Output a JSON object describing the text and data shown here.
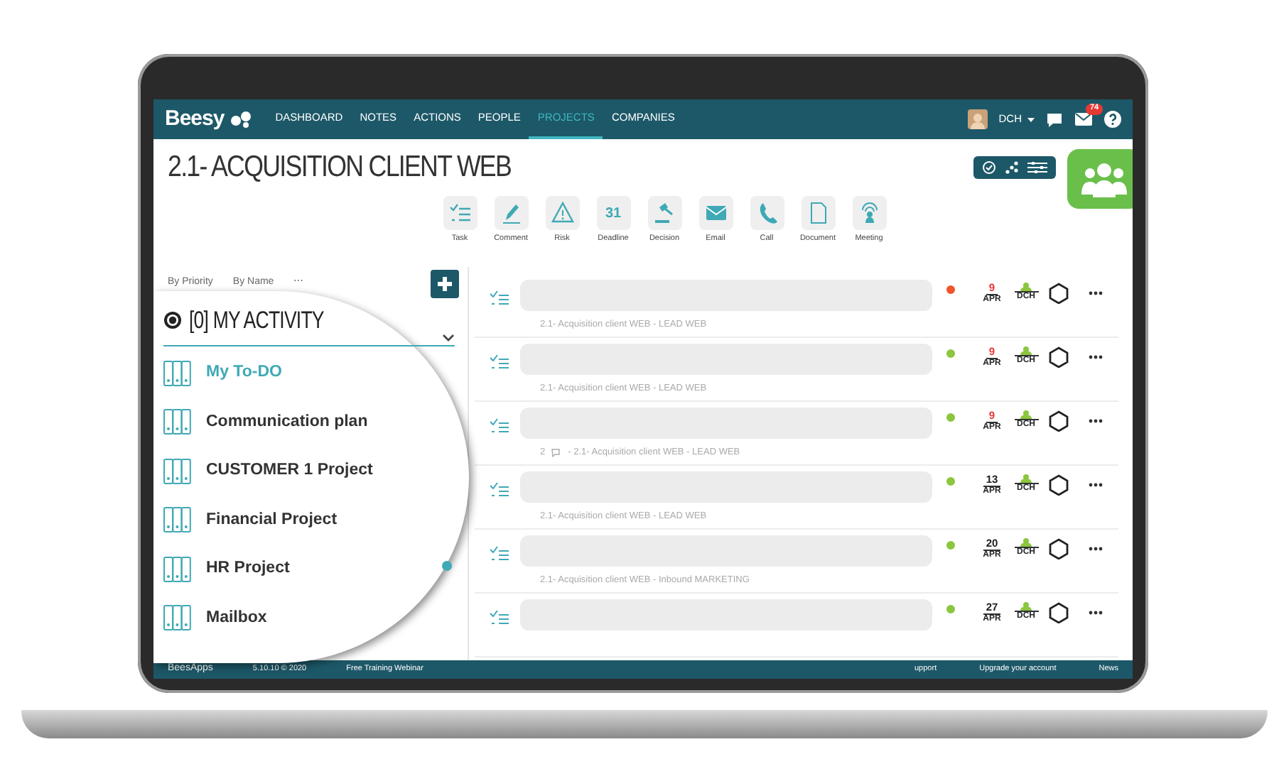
{
  "navbar": {
    "logo": "Beesy",
    "items": [
      {
        "label": "DASHBOARD",
        "selected": false
      },
      {
        "label": "NOTES",
        "selected": false
      },
      {
        "label": "ACTIONS",
        "selected": false
      },
      {
        "label": "PEOPLE",
        "selected": false
      },
      {
        "label": "PROJECTS",
        "selected": true
      },
      {
        "label": "COMPANIES",
        "selected": false
      }
    ],
    "user": "DCH",
    "mail_count": "74"
  },
  "title": "2.1- ACQUISITION CLIENT WEB",
  "actions": [
    {
      "kind": "task",
      "label": "Task"
    },
    {
      "kind": "comment",
      "label": "Comment"
    },
    {
      "kind": "risk",
      "label": "Risk"
    },
    {
      "kind": "deadline",
      "label": "Deadline",
      "glyph": "31"
    },
    {
      "kind": "decision",
      "label": "Decision"
    },
    {
      "kind": "email",
      "label": "Email"
    },
    {
      "kind": "call",
      "label": "Call"
    },
    {
      "kind": "document",
      "label": "Document"
    },
    {
      "kind": "meeting",
      "label": "Meeting"
    }
  ],
  "sort": [
    "By Priority",
    "By Name",
    "⋯"
  ],
  "activity": {
    "title": "[0] MY ACTIVITY",
    "items": [
      {
        "label": "My To-DO",
        "selected": true
      },
      {
        "label": "Communication plan",
        "selected": false
      },
      {
        "label": "CUSTOMER 1 Project",
        "selected": false
      },
      {
        "label": "Financial Project",
        "selected": false
      },
      {
        "label": "HR Project",
        "selected": false
      },
      {
        "label": "Mailbox",
        "selected": false
      }
    ]
  },
  "tasks": [
    {
      "subtitle": "2.1- Acquisition client WEB - LEAD WEB",
      "color": "#f0552a",
      "day": "9",
      "month": "APR",
      "overdue": true,
      "owner": "DCH"
    },
    {
      "subtitle": "2.1- Acquisition client WEB - LEAD WEB",
      "color": "#8cc63f",
      "day": "9",
      "month": "APR",
      "overdue": true,
      "owner": "DCH"
    },
    {
      "comments": "2",
      "subtitle": "- 2.1- Acquisition client WEB - LEAD WEB",
      "color": "#8cc63f",
      "day": "9",
      "month": "APR",
      "overdue": true,
      "owner": "DCH"
    },
    {
      "subtitle": "2.1- Acquisition client WEB - LEAD WEB",
      "color": "#8cc63f",
      "day": "13",
      "month": "APR",
      "overdue": false,
      "owner": "DCH"
    },
    {
      "subtitle": "2.1- Acquisition client WEB - Inbound MARKETING",
      "color": "#8cc63f",
      "day": "20",
      "month": "APR",
      "overdue": false,
      "owner": "DCH"
    },
    {
      "color": "#8cc63f",
      "day": "27",
      "month": "APR",
      "overdue": false,
      "owner": "DCH"
    }
  ],
  "footer": {
    "brand": "BeesApps",
    "version": "5.10.10 © 2020",
    "left_links": [
      "Free Training Webinar"
    ],
    "right_links": [
      "upport",
      "Upgrade your account",
      "News"
    ]
  }
}
